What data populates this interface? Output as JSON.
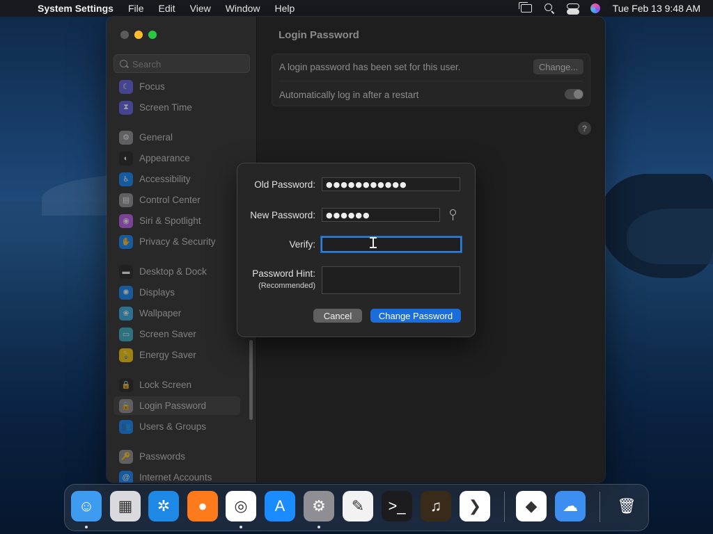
{
  "menubar": {
    "app_name": "System Settings",
    "items": [
      "File",
      "Edit",
      "View",
      "Window",
      "Help"
    ],
    "clock": "Tue Feb 13  9:48 AM"
  },
  "sidebar": {
    "search_placeholder": "Search",
    "items": [
      {
        "label": "Focus",
        "color": "#5e5ce6",
        "glyph": "☾"
      },
      {
        "label": "Screen Time",
        "color": "#5e5ce6",
        "glyph": "⧗"
      },
      {
        "label": "General",
        "color": "#8e8e93",
        "glyph": "⚙"
      },
      {
        "label": "Appearance",
        "color": "#1c1c1e",
        "glyph": "◐"
      },
      {
        "label": "Accessibility",
        "color": "#0a84ff",
        "glyph": "♿"
      },
      {
        "label": "Control Center",
        "color": "#8e8e93",
        "glyph": "▤"
      },
      {
        "label": "Siri & Spotlight",
        "color": "#bf5af2",
        "glyph": "◉"
      },
      {
        "label": "Privacy & Security",
        "color": "#0a84ff",
        "glyph": "✋"
      },
      {
        "label": "Desktop & Dock",
        "color": "#1c1c1e",
        "glyph": "▬"
      },
      {
        "label": "Displays",
        "color": "#0a84ff",
        "glyph": "✺"
      },
      {
        "label": "Wallpaper",
        "color": "#32ade6",
        "glyph": "❀"
      },
      {
        "label": "Screen Saver",
        "color": "#30b0c7",
        "glyph": "▭"
      },
      {
        "label": "Energy Saver",
        "color": "#ffcc00",
        "glyph": "💡"
      },
      {
        "label": "Lock Screen",
        "color": "#1c1c1e",
        "glyph": "🔒"
      },
      {
        "label": "Login Password",
        "color": "#8e8e93",
        "glyph": "🔒"
      },
      {
        "label": "Users & Groups",
        "color": "#0a84ff",
        "glyph": "👥"
      },
      {
        "label": "Passwords",
        "color": "#8e8e93",
        "glyph": "🔑"
      },
      {
        "label": "Internet Accounts",
        "color": "#0a84ff",
        "glyph": "@"
      }
    ]
  },
  "content": {
    "title": "Login Password",
    "password_set_text": "A login password has been set for this user.",
    "change_label": "Change...",
    "auto_login_label": "Automatically log in after a restart",
    "help_label": "?"
  },
  "dialog": {
    "old_label": "Old Password:",
    "old_value": "●●●●●●●●●●●",
    "new_label": "New Password:",
    "new_value": "●●●●●●",
    "verify_label": "Verify:",
    "verify_value": "",
    "hint_label": "Password Hint:",
    "hint_sublabel": "(Recommended)",
    "hint_value": "",
    "cancel_label": "Cancel",
    "submit_label": "Change Password"
  },
  "dock": {
    "apps": [
      {
        "name": "Finder",
        "glyph": "☺",
        "bg": "#3d9bf0",
        "running": true
      },
      {
        "name": "Launchpad",
        "glyph": "▦",
        "bg": "#d9d9de",
        "running": false
      },
      {
        "name": "Safari",
        "glyph": "✲",
        "bg": "#1e88e5",
        "running": false
      },
      {
        "name": "Firefox",
        "glyph": "●",
        "bg": "#ff7a1a",
        "running": false
      },
      {
        "name": "Chrome",
        "glyph": "◎",
        "bg": "#ffffff",
        "running": true
      },
      {
        "name": "App Store",
        "glyph": "A",
        "bg": "#1a8cff",
        "running": false
      },
      {
        "name": "System Settings",
        "glyph": "⚙",
        "bg": "#8e8e93",
        "running": true
      },
      {
        "name": "TextEdit",
        "glyph": "✎",
        "bg": "#f2f2f2",
        "running": false
      },
      {
        "name": "Terminal",
        "glyph": ">_",
        "bg": "#1c1c1e",
        "running": false
      },
      {
        "name": "GarageBand",
        "glyph": "♫",
        "bg": "#3a2a1a",
        "running": false
      },
      {
        "name": "Visual Studio Code",
        "glyph": "❯",
        "bg": "#ffffff",
        "running": false
      },
      {
        "name": "Visual Studio",
        "glyph": "◆",
        "bg": "#ffffff",
        "running": false
      },
      {
        "name": "Weather",
        "glyph": "☁",
        "bg": "#3c8ff0",
        "running": false
      },
      {
        "name": "Trash",
        "glyph": "🗑",
        "bg": "transparent",
        "running": false
      }
    ]
  }
}
